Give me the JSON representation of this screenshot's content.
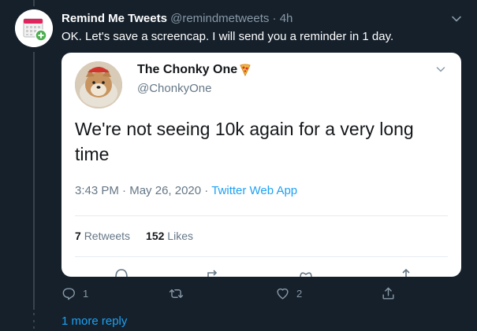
{
  "tweet": {
    "display_name": "Remind Me Tweets",
    "handle": "@remindmetweets",
    "separator": "·",
    "time": "4h",
    "text": "OK. Let's save a screencap. I will send you a reminder in 1 day."
  },
  "quoted": {
    "display_name": "The Chonky One",
    "name_emoji": "pizza-icon",
    "handle": "@ChonkyOne",
    "text": "We're not seeing 10k again for a very long time",
    "time": "3:43 PM",
    "meta_separator": "·",
    "date": "May 26, 2020",
    "meta_separator2": "·",
    "app": "Twitter Web App",
    "retweets_count": "7",
    "retweets_label": "Retweets",
    "likes_count": "152",
    "likes_label": "Likes"
  },
  "actions": {
    "reply_count": "1",
    "retweet_count": "",
    "like_count": "2"
  },
  "footer": {
    "more_replies": "1 more reply"
  },
  "colors": {
    "background": "#15202b",
    "accent": "#1da1f2",
    "muted": "#8899a6"
  }
}
